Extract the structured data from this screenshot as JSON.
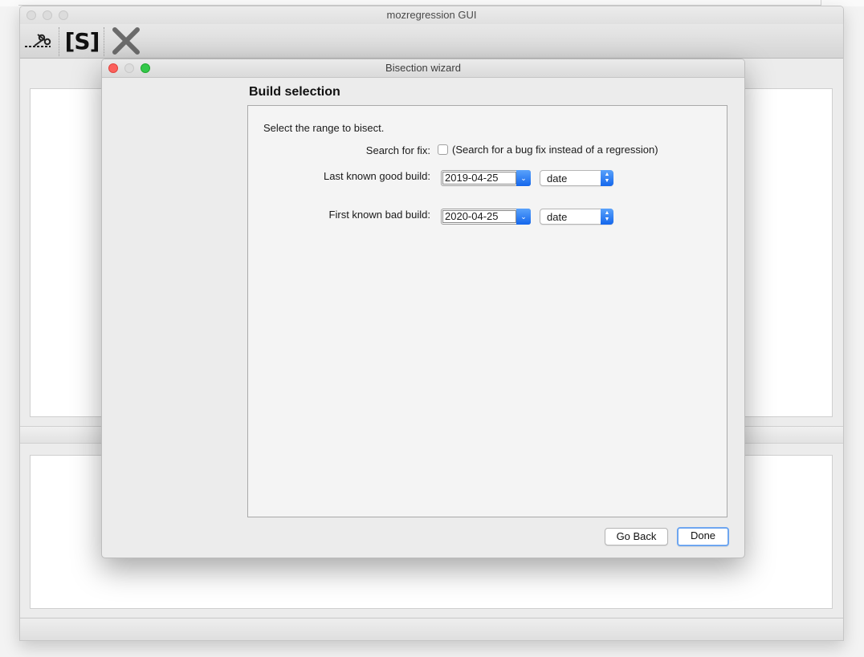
{
  "main_window": {
    "title": "mozregression GUI",
    "toolbar": {
      "new_bisection": {
        "icon": "scissors-icon"
      },
      "run_single": {
        "icon": "bracket-s-icon",
        "label": "[S]"
      },
      "stop": {
        "icon": "close-x-icon"
      }
    }
  },
  "wizard": {
    "title": "Bisection wizard",
    "page_heading": "Build selection",
    "prompt": "Select the range to bisect.",
    "search_fix": {
      "label": "Search for fix:",
      "checked": false,
      "text": "(Search for a bug fix instead of a regression)"
    },
    "good_build": {
      "label": "Last known good build:",
      "value": "2019-04-25",
      "type": "date"
    },
    "bad_build": {
      "label": "First known bad build:",
      "value": "2020-04-25",
      "type": "date"
    },
    "buttons": {
      "back": "Go Back",
      "done": "Done"
    }
  },
  "colors": {
    "accent": "#1a6ff0",
    "close_light": "#fc605c",
    "minimize_light": "#dcdcdc",
    "zoom_light": "#34c84a"
  }
}
